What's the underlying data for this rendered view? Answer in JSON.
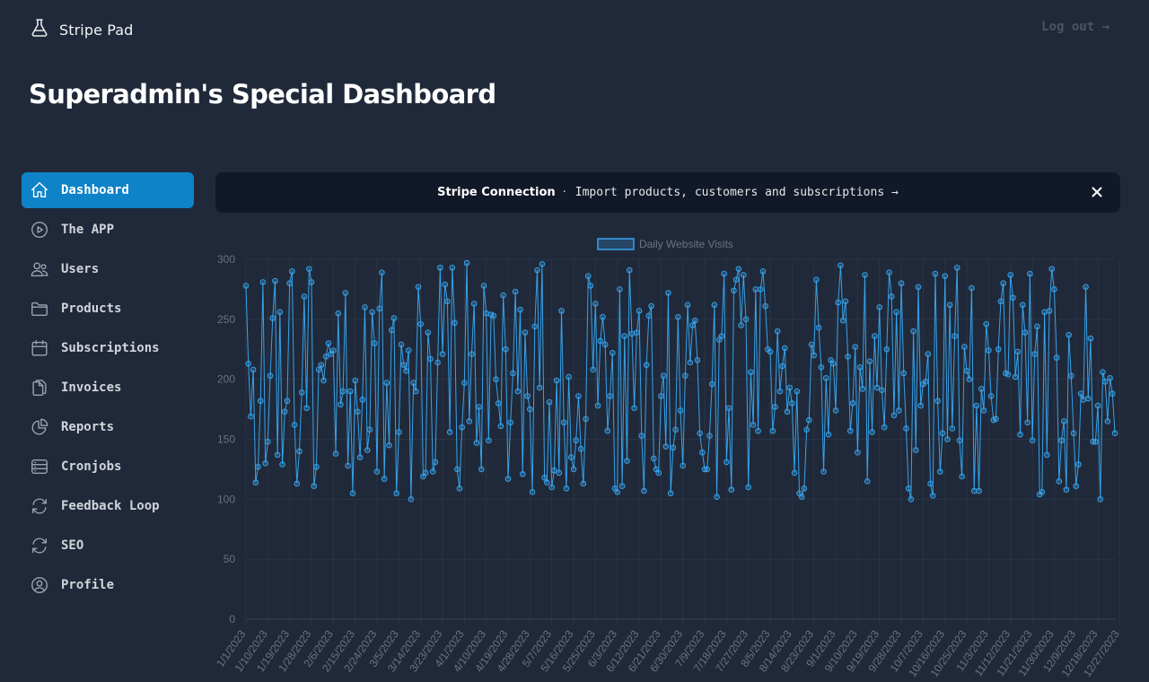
{
  "app": {
    "brand": "Stripe Pad",
    "logout": "Log out →"
  },
  "page": {
    "title": "Superadmin's Special Dashboard"
  },
  "sidebar": {
    "items": [
      {
        "label": "Dashboard",
        "icon": "home-icon",
        "active": true
      },
      {
        "label": "The APP",
        "icon": "play-circle-icon",
        "active": false
      },
      {
        "label": "Users",
        "icon": "users-icon",
        "active": false
      },
      {
        "label": "Products",
        "icon": "folder-icon",
        "active": false
      },
      {
        "label": "Subscriptions",
        "icon": "calendar-icon",
        "active": false
      },
      {
        "label": "Invoices",
        "icon": "documents-icon",
        "active": false
      },
      {
        "label": "Reports",
        "icon": "pie-chart-icon",
        "active": false
      },
      {
        "label": "Cronjobs",
        "icon": "server-icon",
        "active": false
      },
      {
        "label": "Feedback Loop",
        "icon": "refresh-icon",
        "active": false
      },
      {
        "label": "SEO",
        "icon": "refresh-icon",
        "active": false
      },
      {
        "label": "Profile",
        "icon": "user-circle-icon",
        "active": false
      }
    ]
  },
  "banner": {
    "title": "Stripe Connection",
    "separator": "·",
    "link": "Import products, customers and subscriptions →"
  },
  "colors": {
    "accent": "#0f83c7",
    "line": "#36a2eb",
    "background": "#202939"
  },
  "chart_data": {
    "type": "line",
    "legend": "Daily Website Visits",
    "legend_position": "top-center",
    "grid": true,
    "ylim": [
      0,
      300
    ],
    "y_ticks": [
      "0",
      "50",
      "100",
      "150",
      "200",
      "250",
      "300"
    ],
    "x_tick_labels": [
      "1/1/2023",
      "1/10/2023",
      "1/19/2023",
      "1/28/2023",
      "2/6/2023",
      "2/15/2023",
      "2/24/2023",
      "3/5/2023",
      "3/14/2023",
      "3/23/2023",
      "4/1/2023",
      "4/10/2023",
      "4/19/2023",
      "4/28/2023",
      "5/7/2023",
      "5/16/2023",
      "5/25/2023",
      "6/3/2023",
      "6/12/2023",
      "6/21/2023",
      "6/30/2023",
      "7/9/2023",
      "7/18/2023",
      "7/27/2023",
      "8/5/2023",
      "8/14/2023",
      "8/23/2023",
      "9/1/2023",
      "9/10/2023",
      "9/19/2023",
      "9/28/2023",
      "10/7/2023",
      "10/16/2023",
      "10/25/2023",
      "11/3/2023",
      "11/12/2023",
      "11/21/2023",
      "11/30/2023",
      "12/9/2023",
      "12/18/2023",
      "12/27/2023"
    ],
    "x_start": "1/1/2023",
    "x_end": "12/31/2023",
    "values": [
      278,
      213,
      169,
      208,
      114,
      127,
      182,
      281,
      130,
      148,
      203,
      251,
      282,
      137,
      256,
      129,
      173,
      182,
      280,
      290,
      162,
      113,
      140,
      189,
      269,
      176,
      292,
      281,
      111,
      127,
      208,
      212,
      199,
      219,
      230,
      221,
      224,
      138,
      255,
      179,
      190,
      272,
      128,
      190,
      105,
      199,
      173,
      135,
      183,
      260,
      141,
      158,
      256,
      230,
      123,
      259,
      289,
      117,
      197,
      145,
      241,
      251,
      105,
      156,
      229,
      212,
      207,
      224,
      100,
      197,
      190,
      277,
      246,
      119,
      122,
      239,
      217,
      123,
      131,
      214,
      293,
      221,
      279,
      265,
      156,
      293,
      247,
      125,
      109,
      160,
      197,
      297,
      165,
      221,
      263,
      147,
      177,
      125,
      278,
      255,
      149,
      254,
      253,
      200,
      180,
      161,
      270,
      225,
      117,
      164,
      205,
      273,
      190,
      258,
      121,
      239,
      186,
      175,
      106,
      244,
      291,
      193,
      296,
      118,
      114,
      181,
      110,
      124,
      199,
      122,
      257,
      164,
      109,
      202,
      135,
      125,
      149,
      186,
      142,
      113,
      167,
      286,
      278,
      208,
      263,
      178,
      232,
      252,
      229,
      157,
      186,
      222,
      109,
      106,
      275,
      111,
      236,
      132,
      291,
      238,
      176,
      239,
      257,
      153,
      107,
      212,
      253,
      261,
      134,
      125,
      122,
      186,
      203,
      144,
      272,
      105,
      143,
      158,
      252,
      174,
      128,
      203,
      262,
      214,
      245,
      249,
      216,
      155,
      139,
      125,
      125,
      153,
      196,
      262,
      102,
      233,
      236,
      288,
      131,
      176,
      108,
      274,
      283,
      292,
      245,
      287,
      250,
      110,
      206,
      162,
      275,
      157,
      275,
      290,
      261,
      225,
      223,
      157,
      177,
      240,
      190,
      211,
      226,
      173,
      193,
      180,
      122,
      190,
      105,
      102,
      109,
      158,
      166,
      229,
      220,
      283,
      243,
      210,
      123,
      201,
      154,
      216,
      213,
      174,
      264,
      295,
      249,
      265,
      219,
      157,
      180,
      227,
      139,
      210,
      192,
      287,
      115,
      215,
      156,
      236,
      193,
      260,
      191,
      160,
      225,
      289,
      269,
      170,
      256,
      174,
      280,
      205,
      159,
      109,
      100,
      240,
      141,
      277,
      178,
      196,
      198,
      221,
      113,
      103,
      288,
      182,
      123,
      155,
      286,
      150,
      262,
      159,
      236,
      293,
      149,
      119,
      227,
      207,
      200,
      276,
      107,
      178,
      107,
      192,
      174,
      246,
      224,
      186,
      166,
      167,
      225,
      265,
      280,
      205,
      204,
      287,
      268,
      202,
      223,
      154,
      262,
      239,
      164,
      288,
      149,
      221,
      244,
      104,
      106,
      256,
      137,
      257,
      292,
      275,
      218,
      115,
      149,
      165,
      108,
      237,
      203,
      155,
      111,
      129,
      188,
      183,
      277,
      184,
      234,
      148,
      148,
      178,
      100,
      206,
      198,
      165,
      201,
      188,
      155
    ]
  }
}
